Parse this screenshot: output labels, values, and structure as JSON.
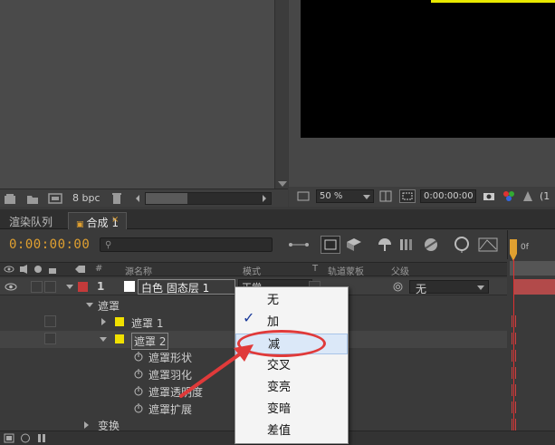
{
  "project_panel": {
    "bpc": "8 bpc"
  },
  "viewer": {
    "zoom": "50 %",
    "timecode": "0:00:00:00",
    "extra": "(1"
  },
  "tabs": [
    {
      "label": "渲染队列"
    },
    {
      "label": "合成 1"
    }
  ],
  "tab_close": "×",
  "timeline": {
    "current_time": "0:00:00:00",
    "search_placeholder": "",
    "ruler_label": "0f"
  },
  "columns": {
    "num": "#",
    "source_name": "源名称",
    "mode": "模式",
    "t": "T",
    "track_matte": "轨道蒙板",
    "parent": "父级"
  },
  "layer": {
    "number": "1",
    "name": "白色 固态层 1",
    "mode": "正常",
    "parent": "无",
    "color": "#c43a3a"
  },
  "tree": [
    {
      "label": "遮罩",
      "level": 1
    },
    {
      "label": "遮罩 1",
      "level": 2
    },
    {
      "label": "遮罩 2",
      "level": 2
    },
    {
      "label": "遮罩形状",
      "level": 3
    },
    {
      "label": "遮罩羽化",
      "level": 3
    },
    {
      "label": "遮罩透明度",
      "level": 3
    },
    {
      "label": "遮罩扩展",
      "level": 3
    },
    {
      "label": "变换",
      "level": 1
    }
  ],
  "blend_menu": {
    "items": [
      "无",
      "加",
      "减",
      "交叉",
      "变亮",
      "变暗",
      "差值"
    ],
    "checked_index": 1,
    "highlighted_index": 2
  },
  "colors": {
    "accent_time": "#e0a030",
    "annotation": "#e03a3a",
    "mask_yellow": "#f0e000"
  },
  "checkmark": "✓"
}
